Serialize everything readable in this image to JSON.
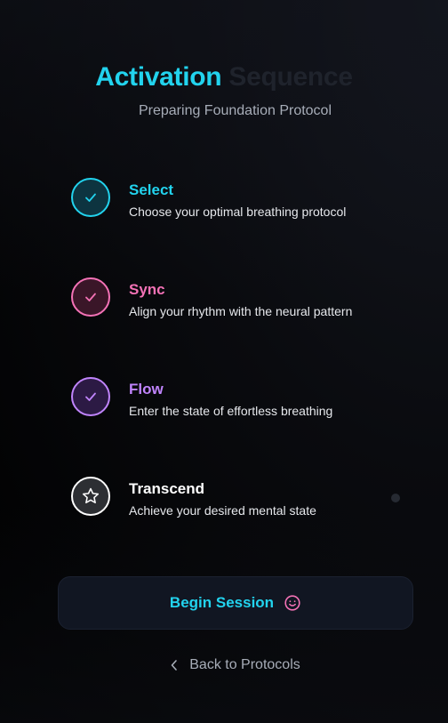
{
  "header": {
    "title_part1": "Activation",
    "title_part2": "Sequence",
    "subtitle": "Preparing Foundation Protocol"
  },
  "steps": [
    {
      "title": "Select",
      "description": "Choose your optimal breathing protocol",
      "icon": "check-icon",
      "color": "#22d3ee",
      "status": "complete"
    },
    {
      "title": "Sync",
      "description": "Align your rhythm with the neural pattern",
      "icon": "check-icon",
      "color": "#f472b6",
      "status": "complete"
    },
    {
      "title": "Flow",
      "description": "Enter the state of effortless breathing",
      "icon": "check-icon",
      "color": "#c084fc",
      "status": "complete"
    },
    {
      "title": "Transcend",
      "description": "Achieve your desired mental state",
      "icon": "star-icon",
      "color": "#ffffff",
      "status": "current"
    }
  ],
  "actions": {
    "begin_label": "Begin Session",
    "begin_icon": "smile-icon",
    "back_label": "Back to Protocols",
    "back_icon": "chevron-left-icon"
  },
  "colors": {
    "accent": "#22d3ee",
    "pink": "#f472b6",
    "purple": "#c084fc"
  }
}
